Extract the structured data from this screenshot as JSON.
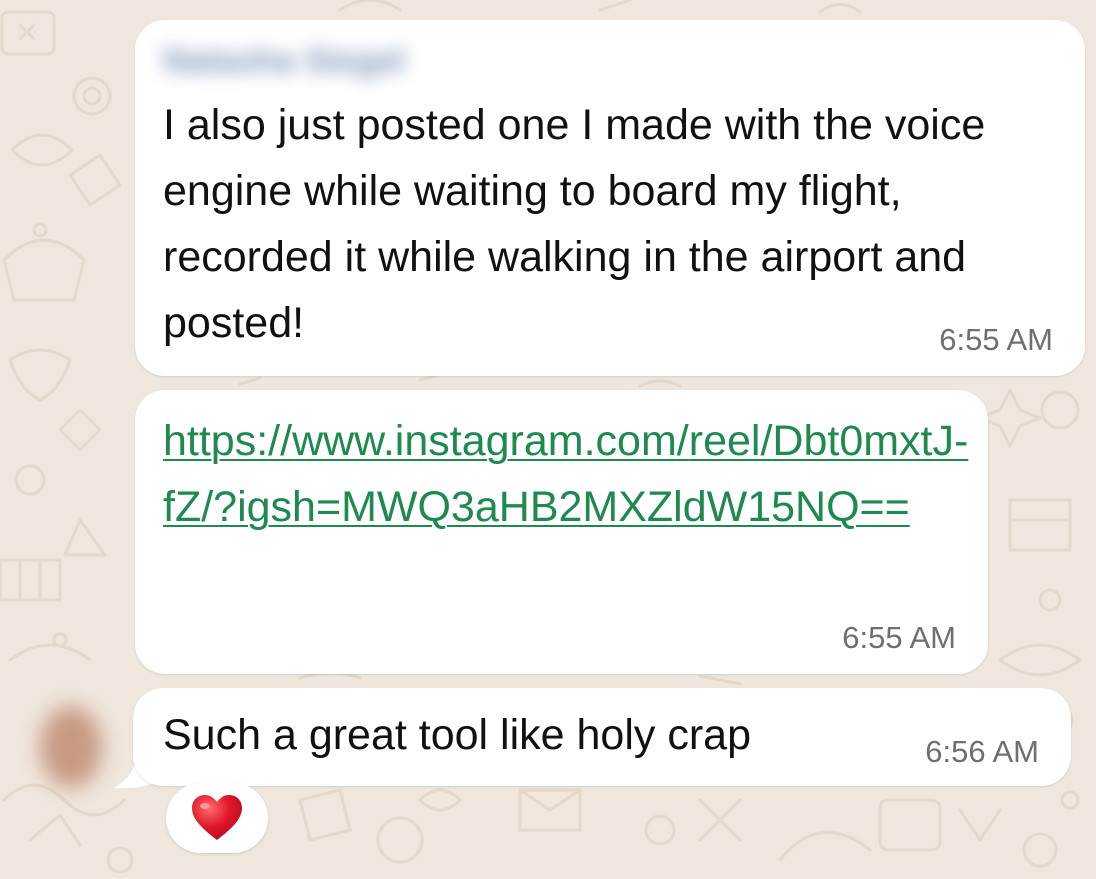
{
  "messages": [
    {
      "sender": "Natasha Siegel",
      "text": "I also just posted one I made with the voice engine while waiting to board my flight, recorded it while walking in the airport and posted!",
      "time": "6:55 AM"
    },
    {
      "link": "https://www.instagram.com/reel/Dbt0mxtJ-fZ/?igsh=MWQ3aHB2MXZldW15NQ==",
      "time": "6:55 AM"
    },
    {
      "text": "Such a great tool like holy crap",
      "time": "6:56 AM",
      "reaction": "❤️"
    }
  ],
  "colors": {
    "wallpaper": "#efe7dd",
    "bubble": "#ffffff",
    "link": "#1e8a4f",
    "timestamp": "#6f6f6f",
    "heart": "#e0162b"
  },
  "icons": {
    "reaction": "red-heart-icon"
  }
}
